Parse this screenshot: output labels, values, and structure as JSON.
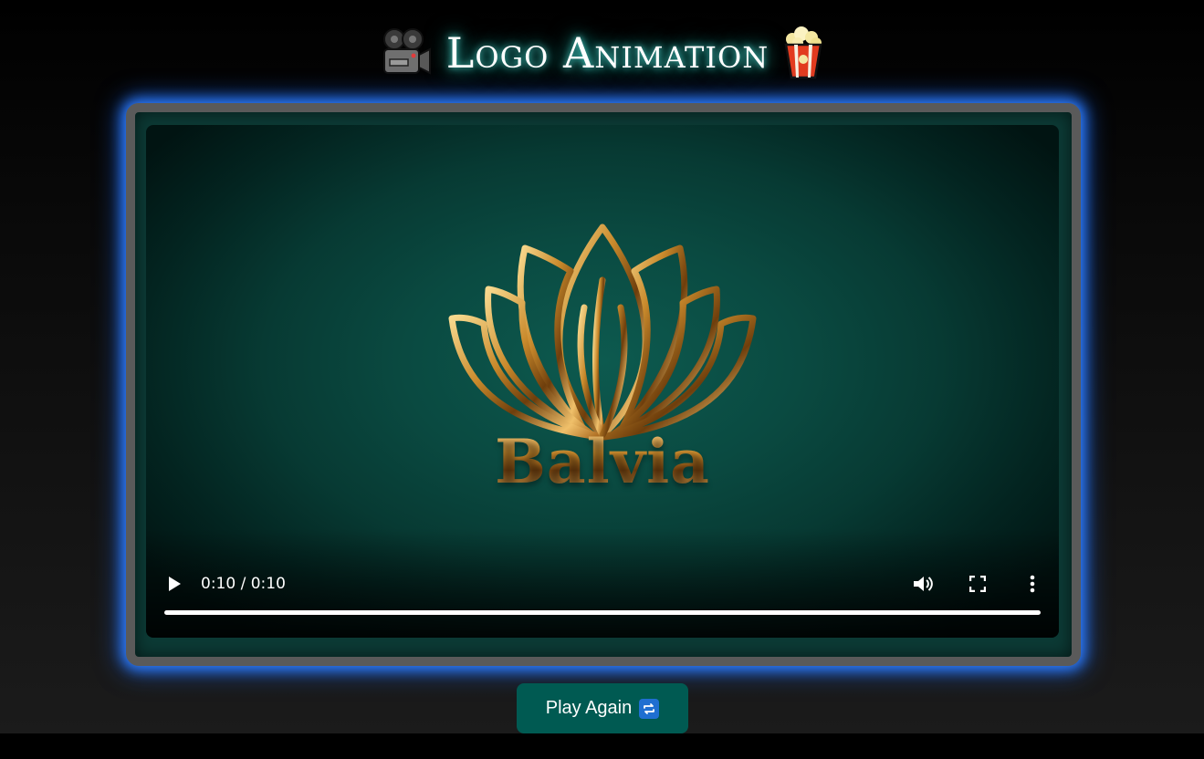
{
  "header": {
    "title": "Logo Animation",
    "left_icon": "movie-camera-icon",
    "right_icon": "popcorn-icon"
  },
  "video": {
    "brand_text": "Balvia",
    "time_display": "0:10 / 0:10",
    "progress_fraction": 1.0,
    "controls": [
      "play-icon",
      "volume-icon",
      "fullscreen-icon",
      "more-options-icon"
    ]
  },
  "play_again": {
    "label": "Play Again",
    "icon": "repeat-icon"
  },
  "colors": {
    "glow_blue": "#2e7dff",
    "title_glow": "#21a89e",
    "button_bg": "#005a52",
    "gold": "#c98a2c"
  }
}
